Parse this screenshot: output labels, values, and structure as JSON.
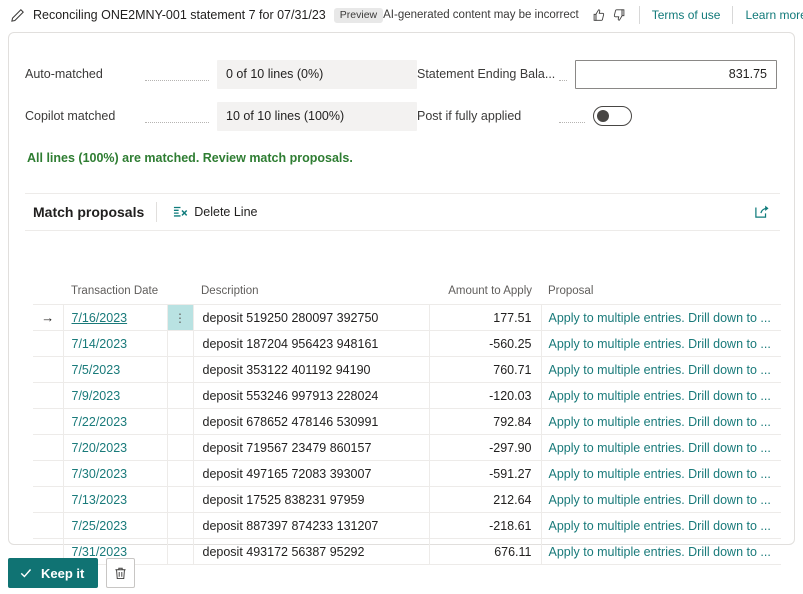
{
  "topbar": {
    "pencil_icon": "pencil-icon",
    "title": "Reconciling ONE2MNY-001 statement 7 for 07/31/23",
    "preview_badge": "Preview",
    "ai_disclaimer": "AI-generated content may be incorrect",
    "thumbs_up_icon": "thumbs-up-icon",
    "thumbs_down_icon": "thumbs-down-icon",
    "terms_link": "Terms of use",
    "learn_more_link": "Learn more"
  },
  "form": {
    "auto_matched_label": "Auto-matched",
    "auto_matched_value": "0 of 10 lines (0%)",
    "copilot_matched_label": "Copilot matched",
    "copilot_matched_value": "10 of 10 lines (100%)",
    "statement_ending_balance_label": "Statement Ending Bala...",
    "statement_ending_balance_value": "831.75",
    "post_if_fully_applied_label": "Post if fully applied",
    "post_if_fully_applied_state": "off",
    "status_message": "All lines (100%) are matched. Review match proposals."
  },
  "grid_header": {
    "title": "Match proposals",
    "delete_line_label": "Delete Line",
    "delete_line_icon": "delete-line-icon",
    "share_icon": "share-icon"
  },
  "table": {
    "columns": [
      "Transaction Date",
      "Description",
      "Amount to Apply",
      "Proposal"
    ],
    "row_menu_glyph": "⋮",
    "selected_row_index": 0,
    "selected_row_arrow": "→",
    "rows": [
      {
        "date": "7/16/2023",
        "description": "deposit 519250 280097 392750",
        "amount": "177.51",
        "proposal": "Apply to multiple entries. Drill down to ..."
      },
      {
        "date": "7/14/2023",
        "description": "deposit 187204 956423 948161",
        "amount": "-560.25",
        "proposal": "Apply to multiple entries. Drill down to ..."
      },
      {
        "date": "7/5/2023",
        "description": "deposit 353122 401192 94190",
        "amount": "760.71",
        "proposal": "Apply to multiple entries. Drill down to ..."
      },
      {
        "date": "7/9/2023",
        "description": "deposit 553246 997913 228024",
        "amount": "-120.03",
        "proposal": "Apply to multiple entries. Drill down to ..."
      },
      {
        "date": "7/22/2023",
        "description": "deposit 678652 478146 530991",
        "amount": "792.84",
        "proposal": "Apply to multiple entries. Drill down to ..."
      },
      {
        "date": "7/20/2023",
        "description": "deposit 719567 23479 860157",
        "amount": "-297.90",
        "proposal": "Apply to multiple entries. Drill down to ..."
      },
      {
        "date": "7/30/2023",
        "description": "deposit 497165 72083 393007",
        "amount": "-591.27",
        "proposal": "Apply to multiple entries. Drill down to ..."
      },
      {
        "date": "7/13/2023",
        "description": "deposit 17525 838231 97959",
        "amount": "212.64",
        "proposal": "Apply to multiple entries. Drill down to ..."
      },
      {
        "date": "7/25/2023",
        "description": "deposit 887397 874233 131207",
        "amount": "-218.61",
        "proposal": "Apply to multiple entries. Drill down to ..."
      },
      {
        "date": "7/31/2023",
        "description": "deposit 493172 56387 95292",
        "amount": "676.11",
        "proposal": "Apply to multiple entries. Drill down to ..."
      }
    ]
  },
  "footer": {
    "keep_it_label": "Keep it",
    "keep_it_icon": "check-icon",
    "discard_icon": "trash-icon"
  },
  "colors": {
    "accent_teal": "#107373",
    "link_teal": "#197a7a",
    "success_green": "#2e7d32",
    "selected_cell": "#b9e2e2",
    "readonly_bg": "#f3f2f1",
    "border": "#e1dfdd"
  }
}
